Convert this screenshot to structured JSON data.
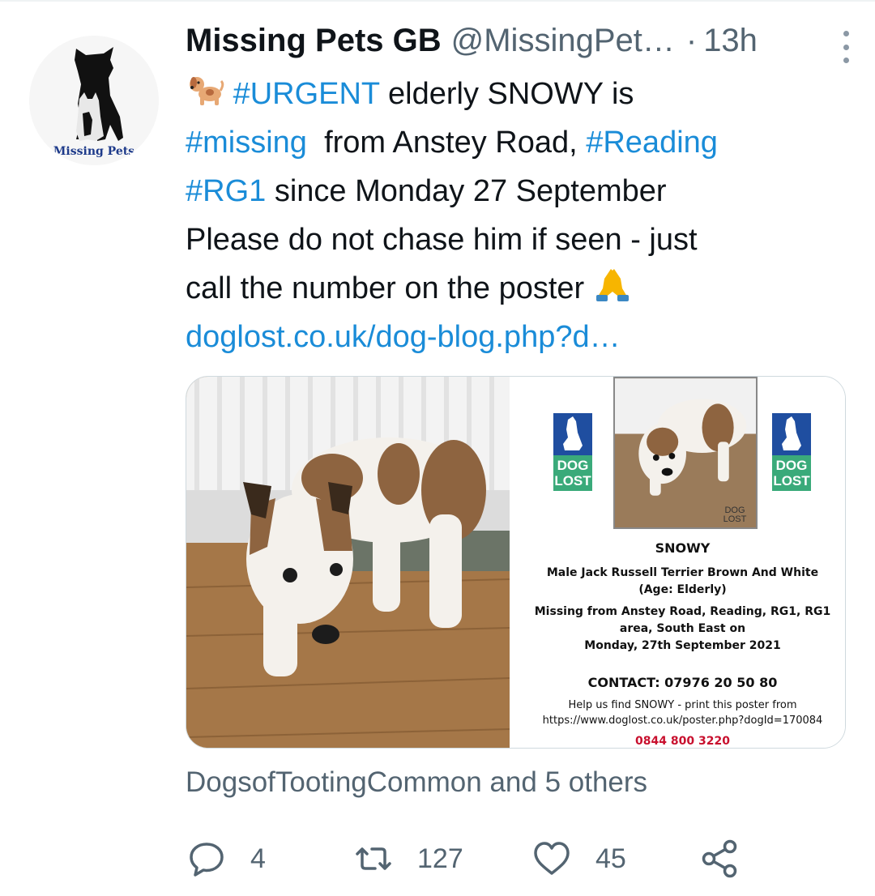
{
  "tweet": {
    "author_name": "Missing Pets GB",
    "handle": "@MissingPet…",
    "separator": "·",
    "time": "13h",
    "avatar_caption": "Missing Pets",
    "text": {
      "line1": {
        "emoji": "dog-icon",
        "tag": "#URGENT",
        "rest": " elderly SNOWY is"
      },
      "line2": {
        "tag1": "#missing",
        "mid": "  from Anstey Road, ",
        "tag2": "#Reading"
      },
      "line3": {
        "tag": "#RG1",
        "rest": " since Monday 27 September"
      },
      "line4": "Please do not chase him if seen - just",
      "line5": {
        "text": "call the number on the poster ",
        "emoji": "folded-hands-icon"
      },
      "link": "doglost.co.uk/dog-blog.php?d…"
    },
    "poster": {
      "logo_text_line1": "DOG",
      "logo_text_line2": "LOST",
      "watermark": "DOG LOST",
      "name": "SNOWY",
      "desc_line1": "Male Jack Russell Terrier Brown And White",
      "desc_line2": "(Age: Elderly)",
      "missing_line1": "Missing from Anstey Road, Reading, RG1, RG1",
      "missing_line2": "area, South East on",
      "missing_line3": "Monday, 27th September 2021",
      "contact": "CONTACT: 07976 20 50 80",
      "help_line1": "Help us find SNOWY - print this poster from",
      "help_line2": "https://www.doglost.co.uk/poster.php?dogId=170084",
      "phone": "0844 800 3220"
    },
    "social_context": "DogsofTootingCommon and 5 others",
    "actions": {
      "reply_count": "4",
      "retweet_count": "127",
      "like_count": "45"
    }
  },
  "colors": {
    "link": "#1a8cd8",
    "secondary_text": "#536471",
    "primary_text": "#0f1419",
    "poster_phone": "#c8102e",
    "doglost_blue": "#1f4ea0",
    "doglost_green": "#3aaa7a"
  }
}
